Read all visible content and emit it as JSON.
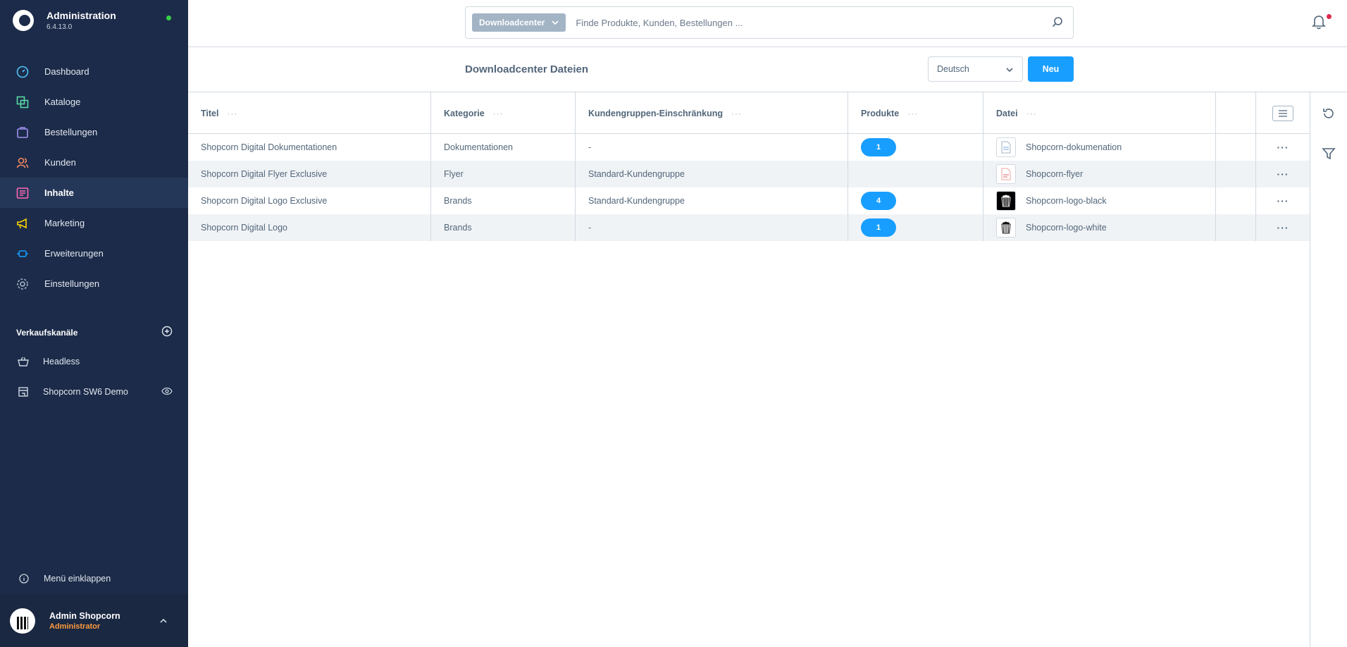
{
  "app": {
    "title": "Administration",
    "version": "6.4.13.0"
  },
  "nav": [
    {
      "label": "Dashboard",
      "icon": "dashboard-icon"
    },
    {
      "label": "Kataloge",
      "icon": "catalog-icon"
    },
    {
      "label": "Bestellungen",
      "icon": "orders-icon"
    },
    {
      "label": "Kunden",
      "icon": "customers-icon"
    },
    {
      "label": "Inhalte",
      "icon": "content-icon",
      "active": true
    },
    {
      "label": "Marketing",
      "icon": "megaphone-icon"
    },
    {
      "label": "Erweiterungen",
      "icon": "extensions-icon"
    },
    {
      "label": "Einstellungen",
      "icon": "gear-icon"
    }
  ],
  "sales_channels": {
    "heading": "Verkaufskanäle",
    "items": [
      {
        "label": "Headless",
        "icon": "basket-icon"
      },
      {
        "label": "Shopcorn SW6 Demo",
        "icon": "storefront-icon"
      }
    ]
  },
  "collapse_label": "Menü einklappen",
  "user": {
    "name": "Admin Shopcorn",
    "role": "Administrator"
  },
  "search": {
    "type_label": "Downloadcenter",
    "placeholder": "Finde Produkte, Kunden, Bestellungen ..."
  },
  "page": {
    "title": "Downloadcenter Dateien",
    "language": "Deutsch",
    "new_label": "Neu"
  },
  "grid": {
    "columns": [
      "Titel",
      "Kategorie",
      "Kundengruppen-Einschränkung",
      "Produkte",
      "Datei"
    ],
    "column_menu": "···",
    "row_menu": "···",
    "rows": [
      {
        "title": "Shopcorn Digital Dokumentationen",
        "category": "Dokumentationen",
        "restriction": "-",
        "products": "1",
        "file": "Shopcorn-dokumenation",
        "thumb": "doc-icon"
      },
      {
        "title": "Shopcorn Digital Flyer Exclusive",
        "category": "Flyer",
        "restriction": "Standard-Kundengruppe",
        "products": "",
        "file": "Shopcorn-flyer",
        "thumb": "pdf-icon"
      },
      {
        "title": "Shopcorn Digital Logo Exclusive",
        "category": "Brands",
        "restriction": "Standard-Kundengruppe",
        "products": "4",
        "file": "Shopcorn-logo-black",
        "thumb": "logo-black-icon"
      },
      {
        "title": "Shopcorn Digital Logo",
        "category": "Brands",
        "restriction": "-",
        "products": "1",
        "file": "Shopcorn-logo-white",
        "thumb": "logo-white-icon"
      }
    ]
  },
  "colors": {
    "sidebar": "#1c2b49",
    "accent": "#189eff",
    "status_online": "#37d046",
    "role": "#ff9a3c"
  }
}
